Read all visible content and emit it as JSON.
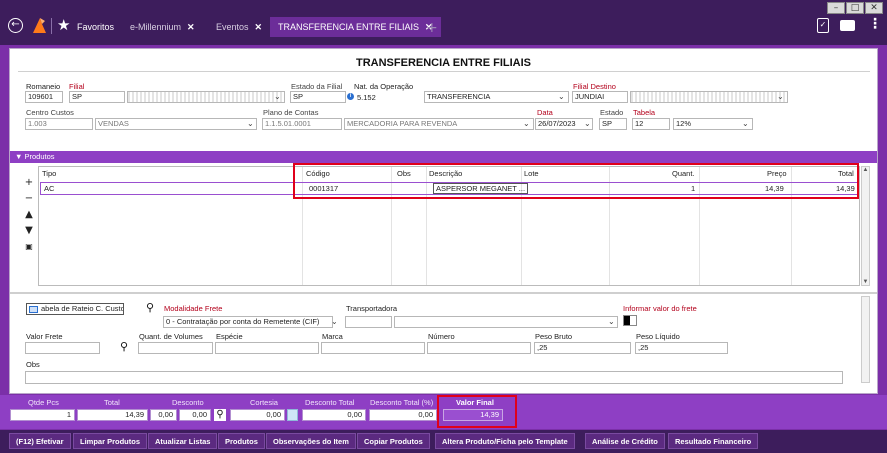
{
  "tabs": [
    {
      "label": "Favoritos"
    },
    {
      "label": "e-Millennium"
    },
    {
      "label": "Eventos"
    },
    {
      "label": "TRANSFERENCIA ENTRE FILIAIS"
    }
  ],
  "form": {
    "title": "TRANSFERENCIA ENTRE FILIAIS",
    "romaneio": {
      "label": "Romaneio",
      "value": "109601"
    },
    "filial": {
      "label": "Filial",
      "code": "SP"
    },
    "estado_filial": {
      "label": "Estado da Filial",
      "value": "SP"
    },
    "nat_operacao": {
      "label": "Nat. da Operação",
      "code": "5.152",
      "desc": "TRANSFERENCIA"
    },
    "filial_destino": {
      "label": "Filial Destino",
      "value": "JUNDIAI"
    },
    "centro_custos": {
      "label": "Centro Custos",
      "code": "1.003",
      "desc": "VENDAS"
    },
    "plano_contas": {
      "label": "Plano de Contas",
      "code": "1.1.5.01.0001",
      "desc": "MERCADORIA PARA REVENDA"
    },
    "data": {
      "label": "Data",
      "value": "26/07/2023"
    },
    "estado": {
      "label": "Estado",
      "value": "SP"
    },
    "tabela": {
      "label": "Tabela",
      "code": "12",
      "desc": "12%"
    }
  },
  "produtos": {
    "section_label": "▼ Produtos",
    "columns": {
      "tipo": "Tipo",
      "codigo": "Código",
      "obs": "Obs",
      "descricao": "Descrição",
      "lote": "Lote",
      "quant": "Quant.",
      "preco": "Preço",
      "total": "Total"
    },
    "rows": [
      {
        "tipo": "AC",
        "codigo": "0001317",
        "obs": "",
        "descricao": "ASPERSOR MEGANET ...",
        "lote": "",
        "quant": "1",
        "preco": "14,39",
        "total": "14,39"
      }
    ]
  },
  "frete": {
    "rateio_label": "abela de Rateio C. Custo",
    "modalidade": {
      "label": "Modalidade Frete",
      "value": "0 - Contratação por conta do Remetente (CIF)"
    },
    "transportadora": {
      "label": "Transportadora"
    },
    "informar_valor": {
      "label": "Informar valor do frete"
    },
    "valor_frete": {
      "label": "Valor Frete"
    },
    "quant_volumes": {
      "label": "Quant. de Volumes"
    },
    "especie": {
      "label": "Espécie"
    },
    "marca": {
      "label": "Marca"
    },
    "numero": {
      "label": "Número"
    },
    "peso_bruto": {
      "label": "Peso Bruto",
      "value": ",25"
    },
    "peso_liquido": {
      "label": "Peso Líquido",
      "value": ",25"
    },
    "obs": {
      "label": "Obs"
    }
  },
  "summary": {
    "qtde_pcs": {
      "label": "Qtde Pcs",
      "value": "1"
    },
    "total": {
      "label": "Total",
      "value": "14,39"
    },
    "desconto": {
      "label": "Desconto",
      "v1": "0,00",
      "v2": "0,00"
    },
    "cortesia": {
      "label": "Cortesia",
      "value": "0,00"
    },
    "desconto_total": {
      "label": "Desconto Total",
      "value": "0,00"
    },
    "desconto_total_pct": {
      "label": "Desconto Total (%)",
      "value": "0,00"
    },
    "valor_final": {
      "label": "Valor Final",
      "value": "14,39"
    }
  },
  "buttons": [
    {
      "label": "(F12) Efetivar"
    },
    {
      "label": "Limpar Produtos"
    },
    {
      "label": "Atualizar Listas"
    },
    {
      "label": "Produtos"
    },
    {
      "label": "Observações do Item"
    },
    {
      "label": "Copiar Produtos"
    },
    {
      "label": "Altera Produto/Ficha pelo Template"
    },
    {
      "label": "Análise de Crédito"
    },
    {
      "label": "Resultado Financeiro"
    }
  ],
  "colors": {
    "accent": "#8e3fc4",
    "topbar": "#3d1d5c",
    "highlight": "#e0001b"
  }
}
